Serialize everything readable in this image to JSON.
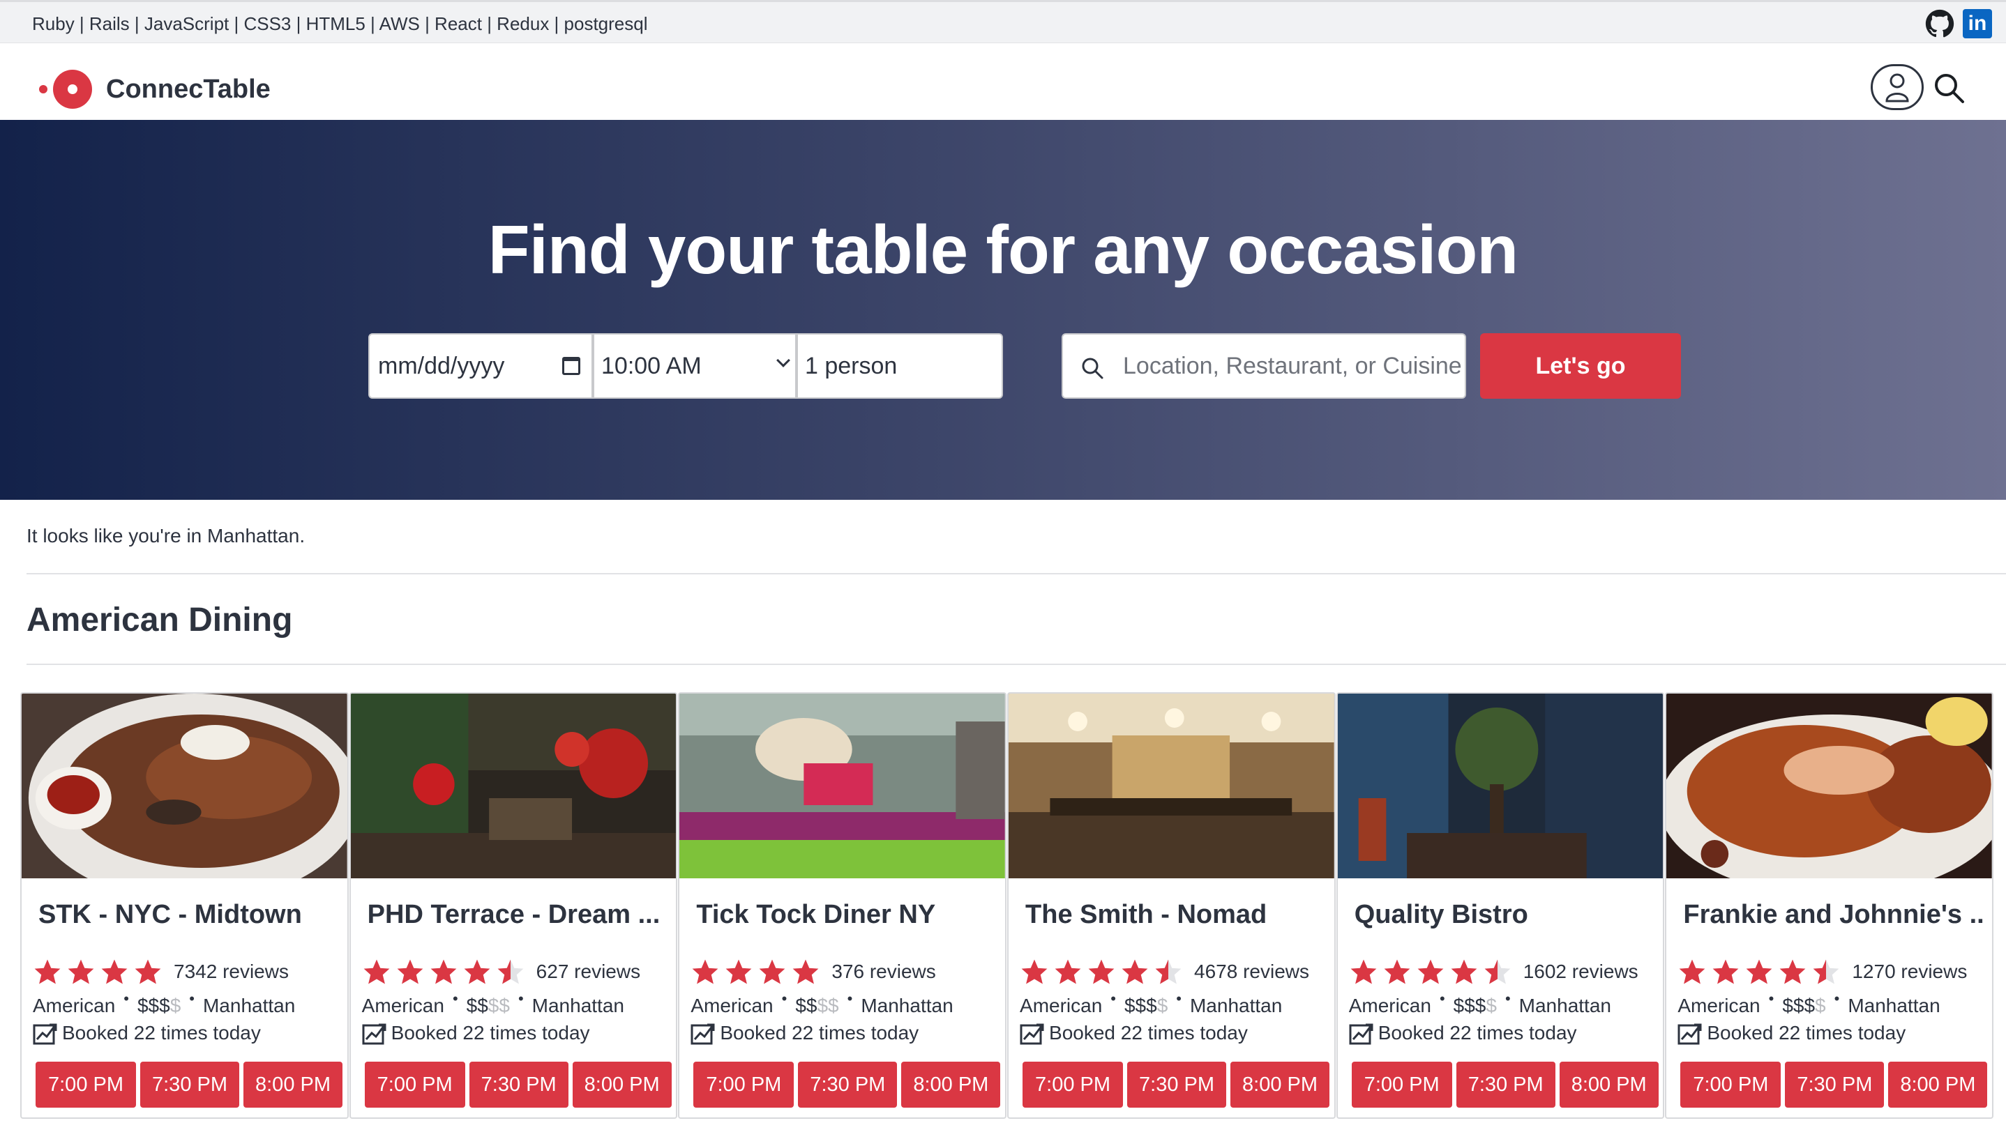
{
  "techbar": {
    "stack": "Ruby | Rails | JavaScript | CSS3 | HTML5 | AWS | React | Redux | postgresql",
    "linkedin": "in"
  },
  "nav": {
    "brand": "ConnecTable"
  },
  "hero": {
    "headline": "Find your table for any occasion",
    "date_placeholder": "mm/dd/yyyy",
    "time_value": "10:00 AM",
    "party_value": "1 person",
    "search_placeholder": "Location, Restaurant, or Cuisine",
    "go_label": "Let's go"
  },
  "location_note": "It looks like you're in Manhattan.",
  "section_title": "American Dining",
  "colors": {
    "accent": "#da3743",
    "text": "#2d333f",
    "hero_start": "#13224a",
    "hero_end": "#6e7191"
  },
  "restaurants": [
    {
      "name": "STK - NYC - Midtown",
      "rating": 4,
      "reviews": "7342 reviews",
      "cuisine": "American",
      "price_on": "$$$",
      "price_off": "$",
      "neighborhood": "Manhattan",
      "booked": "Booked 22 times today",
      "times": [
        "7:00 PM",
        "7:30 PM",
        "8:00 PM"
      ],
      "photo": "steak-photo"
    },
    {
      "name": "PHD Terrace - Dream ...",
      "rating": 4.5,
      "reviews": "627 reviews",
      "cuisine": "American",
      "price_on": "$$",
      "price_off": "$$",
      "neighborhood": "Manhattan",
      "booked": "Booked 22 times today",
      "times": [
        "7:00 PM",
        "7:30 PM",
        "8:00 PM"
      ],
      "photo": "terrace-photo"
    },
    {
      "name": "Tick Tock Diner NY",
      "rating": 4,
      "reviews": "376 reviews",
      "cuisine": "American",
      "price_on": "$$",
      "price_off": "$$",
      "neighborhood": "Manhattan",
      "booked": "Booked 22 times today",
      "times": [
        "7:00 PM",
        "7:30 PM",
        "8:00 PM"
      ],
      "photo": "diner-photo"
    },
    {
      "name": "The Smith - Nomad",
      "rating": 4.5,
      "reviews": "4678 reviews",
      "cuisine": "American",
      "price_on": "$$$",
      "price_off": "$",
      "neighborhood": "Manhattan",
      "booked": "Booked 22 times today",
      "times": [
        "7:00 PM",
        "7:30 PM",
        "8:00 PM"
      ],
      "photo": "bar-photo"
    },
    {
      "name": "Quality Bistro",
      "rating": 4.5,
      "reviews": "1602 reviews",
      "cuisine": "American",
      "price_on": "$$$",
      "price_off": "$",
      "neighborhood": "Manhattan",
      "booked": "Booked 22 times today",
      "times": [
        "7:00 PM",
        "7:30 PM",
        "8:00 PM"
      ],
      "photo": "bistro-photo"
    },
    {
      "name": "Frankie and Johnnie's ...",
      "rating": 4.5,
      "reviews": "1270 reviews",
      "cuisine": "American",
      "price_on": "$$$",
      "price_off": "$",
      "neighborhood": "Manhattan",
      "booked": "Booked 22 times today",
      "times": [
        "7:00 PM",
        "7:30 PM",
        "8:00 PM"
      ],
      "photo": "lobster-photo"
    }
  ]
}
